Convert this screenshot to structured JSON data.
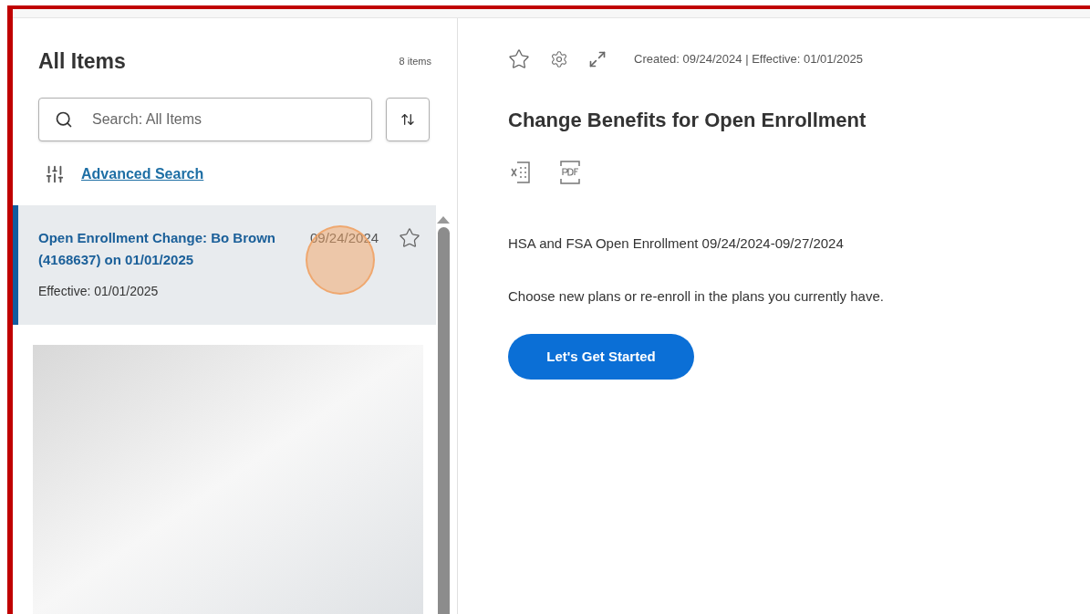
{
  "list": {
    "title": "All Items",
    "count": "8 items",
    "search": {
      "placeholder": "Search: All Items"
    },
    "advanced_search": "Advanced Search",
    "items": [
      {
        "title": "Open Enrollment Change: Bo Brown (4168637) on 01/01/2025",
        "date": "09/24/2024",
        "effective": "Effective: 01/01/2025",
        "selected": true
      }
    ]
  },
  "detail": {
    "meta": "Created: 09/24/2024 | Effective: 01/01/2025",
    "title": "Change Benefits for Open Enrollment",
    "paragraphs": [
      "HSA and FSA Open Enrollment 09/24/2024-09/27/2024",
      "Choose new plans or re-enroll in the plans you currently have."
    ],
    "button": "Let's Get Started"
  }
}
